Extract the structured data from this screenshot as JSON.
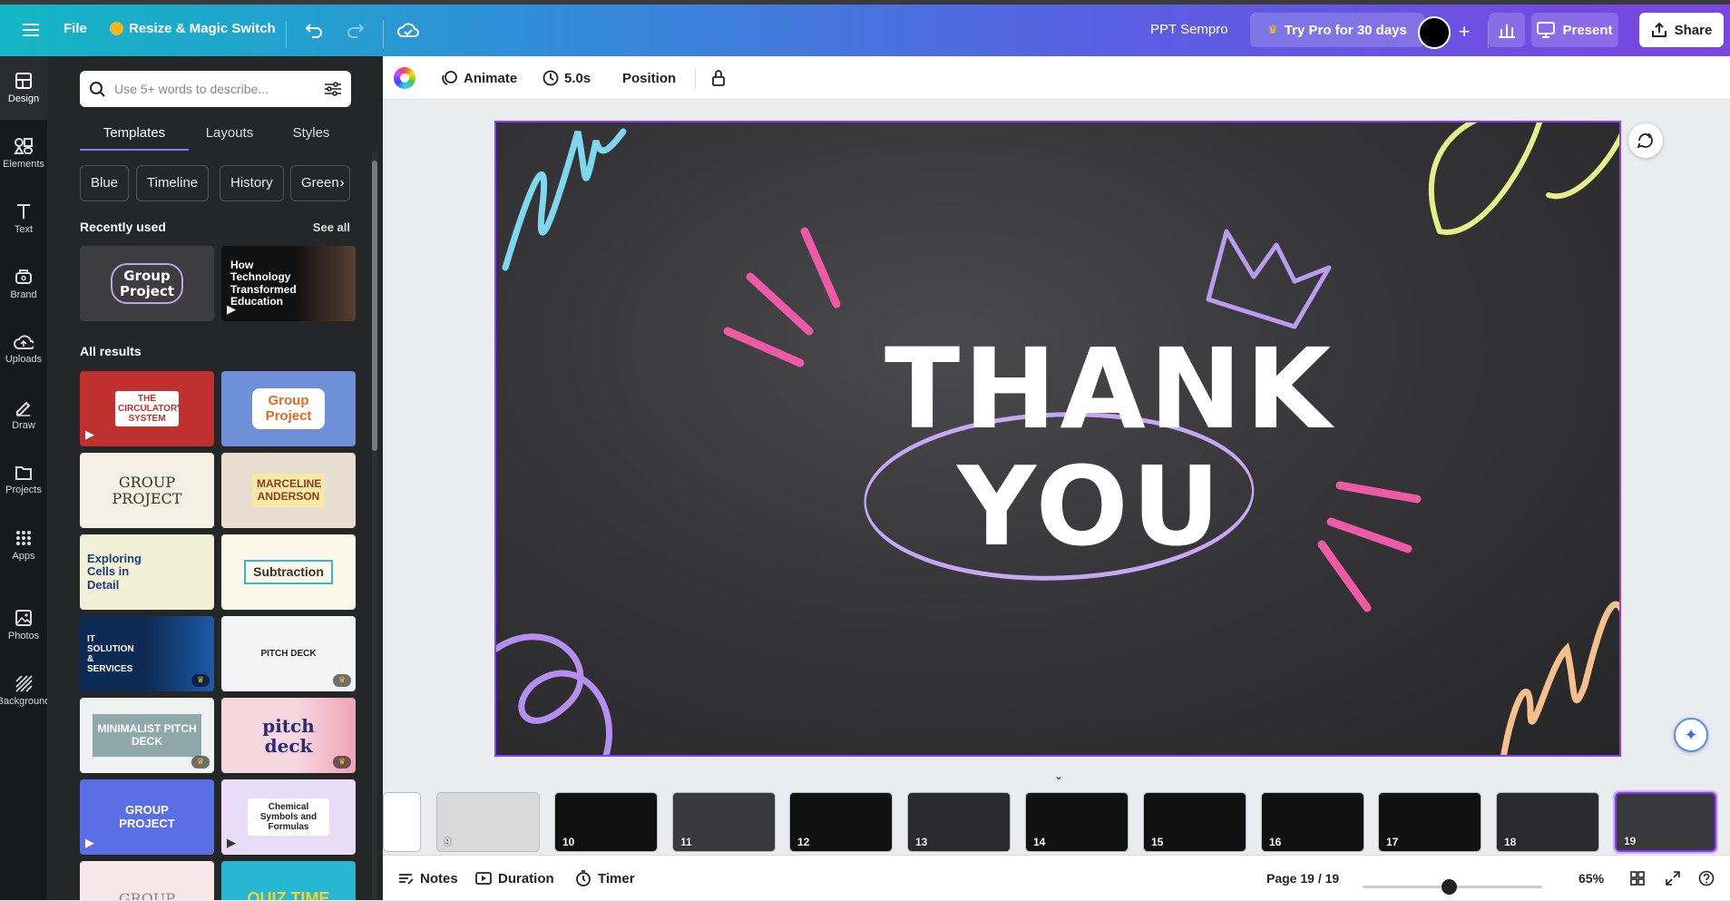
{
  "topbar": {
    "menu_icon": "hamburger-icon",
    "file_label": "File",
    "resize_label": "Resize & Magic Switch",
    "undo_icon": "undo-icon",
    "redo_icon": "redo-icon",
    "cloud_icon": "cloud-saved-icon",
    "doc_title": "PPT Sempro",
    "try_pro_label": "Try Pro for 30 days",
    "add_icon": "plus-icon",
    "stats_icon": "bar-chart-icon",
    "present_label": "Present",
    "share_label": "Share",
    "accent_gradient": [
      "#13b7c4",
      "#7a45e0"
    ]
  },
  "rail": {
    "items": [
      {
        "label": "Design",
        "icon": "design-icon"
      },
      {
        "label": "Elements",
        "icon": "elements-icon"
      },
      {
        "label": "Text",
        "icon": "text-icon"
      },
      {
        "label": "Brand",
        "icon": "brand-icon"
      },
      {
        "label": "Uploads",
        "icon": "uploads-icon"
      },
      {
        "label": "Draw",
        "icon": "draw-icon"
      },
      {
        "label": "Projects",
        "icon": "folder-icon"
      },
      {
        "label": "Apps",
        "icon": "apps-icon"
      },
      {
        "label": "Photos",
        "icon": "photos-icon"
      },
      {
        "label": "Background",
        "icon": "background-icon"
      }
    ]
  },
  "panel": {
    "search_placeholder": "Use 5+ words to describe...",
    "tabs": [
      "Templates",
      "Layouts",
      "Styles"
    ],
    "chips": [
      "Blue",
      "Timeline",
      "History",
      "Green"
    ],
    "recently_used_title": "Recently used",
    "see_all_label": "See all",
    "recent": [
      {
        "text": "Group Project"
      },
      {
        "text": "How Technology Transformed Education"
      }
    ],
    "all_results_title": "All results",
    "results": [
      {
        "text": "THE CIRCULATORY SYSTEM"
      },
      {
        "text": "Group Project"
      },
      {
        "text": "GROUP PROJECT"
      },
      {
        "text": "MARCELINE ANDERSON"
      },
      {
        "text": "Exploring Cells in Detail"
      },
      {
        "text": "Subtraction"
      },
      {
        "text": "IT SOLUTION & SERVICES"
      },
      {
        "text": "PITCH DECK"
      },
      {
        "text": "MINIMALIST PITCH DECK"
      },
      {
        "text": "pitch deck"
      },
      {
        "text": "GROUP PROJECT"
      },
      {
        "text": "Chemical Symbols and Formulas"
      },
      {
        "text": "GROUP"
      },
      {
        "text": "QUIZ TIME"
      }
    ]
  },
  "toolbar2": {
    "animate_label": "Animate",
    "duration_label": "5.0s",
    "position_label": "Position",
    "lock_icon": "lock-icon",
    "color_icon": "color-wheel-icon"
  },
  "slide": {
    "line1": "THANK",
    "line2": "YOU"
  },
  "pages": [
    {
      "num": "",
      "bg": "#ffffff"
    },
    {
      "num": "9",
      "bg": "#d9d9d9"
    },
    {
      "num": "10",
      "bg": "#111111"
    },
    {
      "num": "11",
      "bg": "#3a3a3c"
    },
    {
      "num": "12",
      "bg": "#111111"
    },
    {
      "num": "13",
      "bg": "#2b2b2d"
    },
    {
      "num": "14",
      "bg": "#111111"
    },
    {
      "num": "15",
      "bg": "#111111"
    },
    {
      "num": "16",
      "bg": "#111111"
    },
    {
      "num": "17",
      "bg": "#111111"
    },
    {
      "num": "18",
      "bg": "#2b2b2d"
    },
    {
      "num": "19",
      "bg": "#3a3a3c"
    }
  ],
  "bottombar": {
    "notes_label": "Notes",
    "duration_label": "Duration",
    "timer_label": "Timer",
    "page_label": "Page 19 / 19",
    "zoom_label": "65%",
    "zoom_value": 65
  }
}
